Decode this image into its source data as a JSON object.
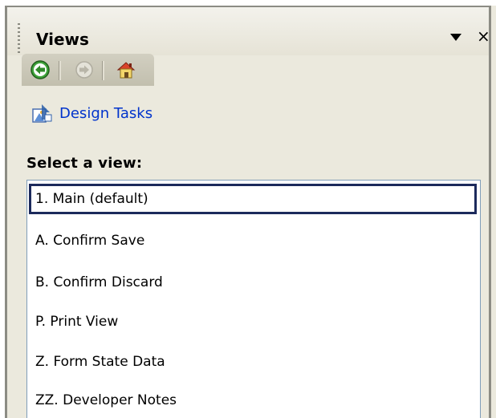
{
  "pane": {
    "title": "Views",
    "dropdown_icon": "triangle-down",
    "close_label": "×"
  },
  "nav": {
    "back_icon": "back-arrow-icon",
    "forward_icon": "forward-arrow-icon",
    "home_icon": "home-icon"
  },
  "design_tasks": {
    "label": "Design Tasks",
    "icon": "design-tasks-icon"
  },
  "views": {
    "heading": "Select a view:",
    "selected_index": 0,
    "items": [
      {
        "label": "1. Main (default)"
      },
      {
        "label": "A. Confirm Save"
      },
      {
        "label": "B. Confirm Discard"
      },
      {
        "label": "P. Print View"
      },
      {
        "label": "Z. Form State Data"
      },
      {
        "label": "ZZ. Developer Notes"
      }
    ]
  },
  "colors": {
    "pane_bg": "#ebe9dd",
    "link": "#0033cc",
    "selection_border": "#1c2a5c",
    "list_border": "#7f9db9"
  }
}
